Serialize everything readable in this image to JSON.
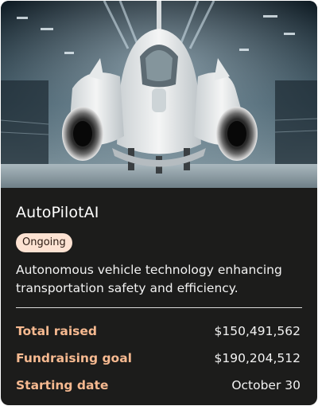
{
  "project": {
    "name": "AutoPilotAI",
    "status": "Ongoing",
    "description": "Autonomous vehicle technology enhancing transportation safety and efficiency.",
    "image_icon": "futuristic-vehicle-image"
  },
  "stats": [
    {
      "label": "Total raised",
      "value": "$150,491,562"
    },
    {
      "label": "Fundraising goal",
      "value": "$190,204,512"
    },
    {
      "label": "Starting date",
      "value": "October 30"
    }
  ],
  "colors": {
    "card_background": "#1c1c1b",
    "badge_background": "#fde2d2",
    "accent_label": "#f6b990",
    "divider": "#d9d9d9"
  }
}
